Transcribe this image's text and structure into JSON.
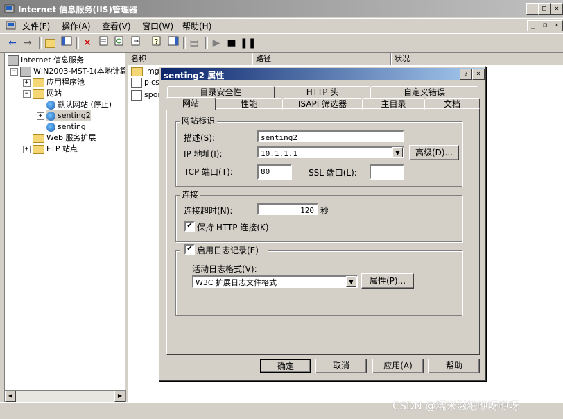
{
  "window": {
    "title": "Internet 信息服务(IIS)管理器"
  },
  "menu": [
    "文件(F)",
    "操作(A)",
    "查看(V)",
    "窗口(W)",
    "帮助(H)"
  ],
  "tree": {
    "root": "Internet 信息服务",
    "server": "WIN2003-MST-1(本地计算机)",
    "app_pools": "应用程序池",
    "websites": "网站",
    "default_site": "默认网站 (停止)",
    "senting2": "senting2",
    "senting": "senting",
    "web_ext": "Web 服务扩展",
    "ftp": "FTP 站点"
  },
  "list": {
    "columns": [
      "名称",
      "路径",
      "状况"
    ],
    "rows": [
      "img",
      "pics",
      "spor"
    ]
  },
  "dialog": {
    "title": "senting2 属性",
    "tabs_row1": [
      "目录安全性",
      "HTTP 头",
      "自定义错误"
    ],
    "tabs_row2": [
      "网站",
      "性能",
      "ISAPI 筛选器",
      "主目录",
      "文档"
    ],
    "identity": {
      "title": "网站标识",
      "desc_label": "描述(S):",
      "desc_value": "senting2",
      "ip_label": "IP 地址(I):",
      "ip_value": "10.1.1.1",
      "advanced": "高级(D)...",
      "tcp_label": "TCP 端口(T):",
      "tcp_value": "80",
      "ssl_label": "SSL 端口(L):",
      "ssl_value": ""
    },
    "connection": {
      "title": "连接",
      "timeout_label": "连接超时(N):",
      "timeout_value": "120",
      "timeout_unit": "秒",
      "keepalive_label": "保持 HTTP 连接(K)",
      "keepalive_checked": true
    },
    "logging": {
      "enable_label": "启用日志记录(E)",
      "enable_checked": true,
      "format_label": "活动日志格式(V):",
      "format_value": "W3C 扩展日志文件格式",
      "props_button": "属性(P)..."
    },
    "buttons": {
      "ok": "确定",
      "cancel": "取消",
      "apply": "应用(A)",
      "help": "帮助"
    }
  },
  "watermark": "CSDN @糯米滋粑咿呀咿呀"
}
